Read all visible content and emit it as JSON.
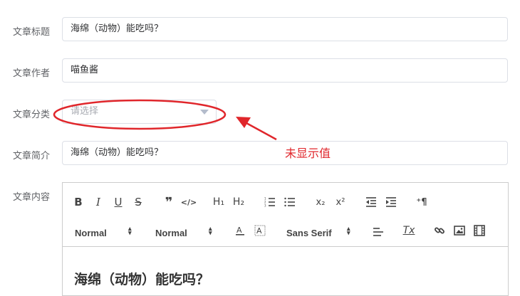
{
  "form": {
    "title": {
      "label": "文章标题",
      "value": "海绵（动物）能吃吗？"
    },
    "author": {
      "label": "文章作者",
      "value": "喵鱼酱"
    },
    "category": {
      "label": "文章分类",
      "placeholder": "请选择"
    },
    "summary": {
      "label": "文章简介",
      "value": "海绵（动物）能吃吗？"
    },
    "content": {
      "label": "文章内容",
      "heading": "海绵（动物）能吃吗？"
    }
  },
  "toolbar": {
    "bold": "B",
    "italic": "I",
    "underline": "U",
    "strike": "S",
    "quote": "❞",
    "code": "</>",
    "h1": "H₁",
    "h2": "H₂",
    "sub": "x₂",
    "sup": "x²",
    "direction": "⁺¶",
    "header_picker": "Normal",
    "size_picker": "Normal",
    "font_picker": "Sans Serif",
    "clean": "Tx"
  },
  "annotation": {
    "text": "未显示值",
    "color": "#e0262b"
  }
}
